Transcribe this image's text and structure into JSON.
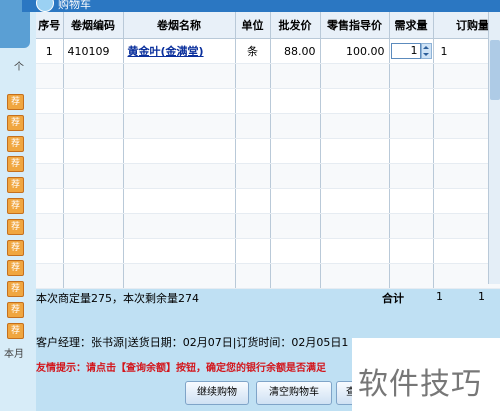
{
  "window": {
    "title": "购物车"
  },
  "left_panel": {
    "chars": [
      "个",
      "本月"
    ],
    "order_icon_glyph": "荐",
    "order_icon_count": 12
  },
  "grid": {
    "columns": [
      "序号",
      "卷烟编码",
      "卷烟名称",
      "单位",
      "批发价",
      "零售指导价",
      "需求量",
      "订购量"
    ],
    "rows": [
      {
        "index": "1",
        "code": "410109",
        "name": "黄金叶(金满堂)",
        "unit": "条",
        "wholesale": "88.00",
        "retail": "100.00",
        "demand": "1",
        "order": "1"
      }
    ],
    "empty_rows": 9
  },
  "summary": {
    "text": "本次商定量275，本次剩余量274",
    "total_label": "合计",
    "total_demand": "1",
    "total_order": "1"
  },
  "info": {
    "text": "客户经理：张书源|送货日期：02月07日|订货时间：02月05日1"
  },
  "tip": {
    "text": "友情提示：请点击【查询余额】按钮，确定您的银行余额是否满足"
  },
  "buttons": {
    "continue": "继续购物",
    "clear": "清空购物车",
    "partial": "查"
  },
  "watermark": {
    "text": "软件技巧"
  },
  "colors": {
    "title_bar": "#2b77c2",
    "tip": "#d3151b",
    "link": "#0a2f9c",
    "background": "#bfe0f3"
  }
}
